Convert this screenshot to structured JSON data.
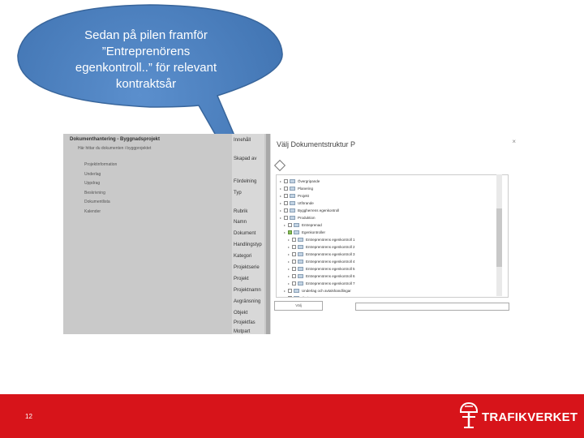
{
  "callout": {
    "line1": "Sedan på pilen framför",
    "line2": "”Entreprenörens",
    "line3": "egenkontroll..” för relevant",
    "line4": "kontraktsår"
  },
  "left_panel": {
    "header": "Dokumenthantering - Byggnadsprojekt",
    "subtitle": "Här hittar du dokumenten i byggprojektet",
    "items": [
      "Projektinformation",
      "Underlag",
      "Uppdrag",
      "Beskrivning",
      "Dokumentlista",
      "Kalender"
    ]
  },
  "form_labels": [
    "Innehåll",
    "Skapad av",
    "",
    "Fördelning",
    "Typ",
    "",
    "Rubrik",
    "Namn",
    "Dokument",
    "Handlingstyp",
    "Kategori",
    "Projektserie",
    "Projekt",
    "Projektnamn",
    "Avgränsning",
    "Objekt",
    "Projektfas",
    "Motpart"
  ],
  "dialog": {
    "title": "Välj Dokumentstruktur P",
    "close_glyph": "×",
    "tree": [
      {
        "label": "Övergripande",
        "level": 0,
        "checked": false
      },
      {
        "label": "Planering",
        "level": 0,
        "checked": false
      },
      {
        "label": "Projekt",
        "level": 0,
        "checked": false
      },
      {
        "label": "Utförande",
        "level": 0,
        "checked": false
      },
      {
        "label": "Byggherrens egenkontroll",
        "level": 0,
        "checked": false
      },
      {
        "label": "Produktion",
        "level": 0,
        "checked": false
      },
      {
        "label": "Entreprenad",
        "level": 1,
        "checked": false
      },
      {
        "label": "Egenkontroller",
        "level": 1,
        "checked": true
      },
      {
        "label": "Entreprenörens egenkontroll 1",
        "level": 2,
        "checked": false
      },
      {
        "label": "Entreprenörens egenkontroll 2",
        "level": 2,
        "checked": false
      },
      {
        "label": "Entreprenörens egenkontroll 3",
        "level": 2,
        "checked": false
      },
      {
        "label": "Entreprenörens egenkontroll 4",
        "level": 2,
        "checked": false
      },
      {
        "label": "Entreprenörens egenkontroll 5",
        "level": 2,
        "checked": false
      },
      {
        "label": "Entreprenörens egenkontroll 6",
        "level": 2,
        "checked": false
      },
      {
        "label": "Entreprenörens egenkontroll 7",
        "level": 2,
        "checked": false
      },
      {
        "label": "Underlag och avtalshandlingar",
        "level": 1,
        "checked": false
      },
      {
        "label": "Övrigt",
        "level": 1,
        "checked": false
      }
    ],
    "select_button": "Välj"
  },
  "footer": {
    "page_number": "12",
    "logo_text": "TRAFIKVERKET"
  },
  "colors": {
    "callout_fill": "#4a7ebb",
    "callout_stroke": "#38659b",
    "footer_red": "#d7141a"
  }
}
